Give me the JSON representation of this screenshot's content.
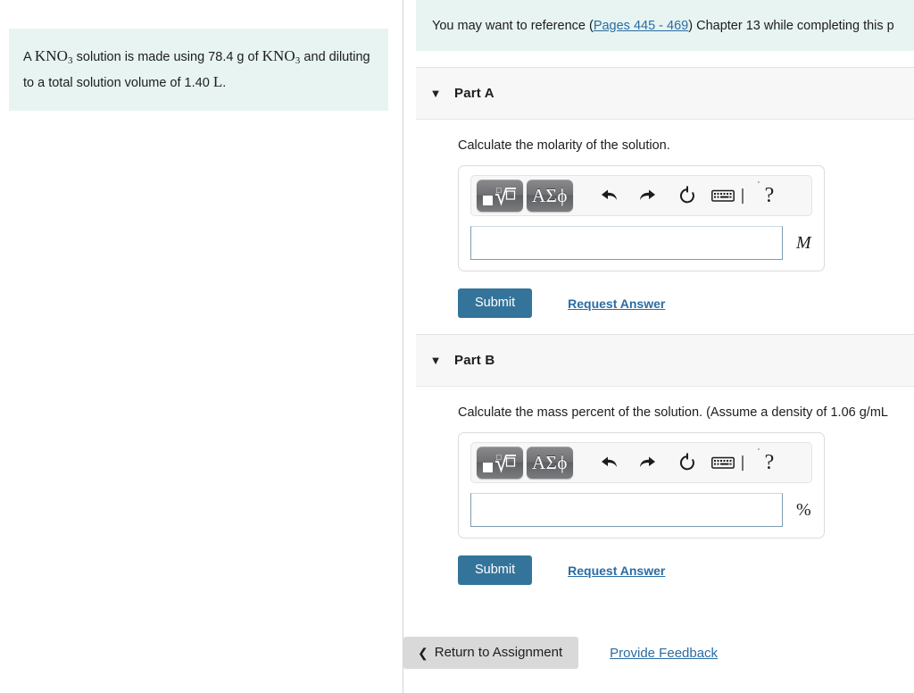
{
  "left": {
    "problem": {
      "line1_pre": "A ",
      "formula1": "KNO",
      "formula1_sub": "3",
      "line1_mid": " solution is made using 78.4 g of ",
      "formula2": "KNO",
      "formula2_sub": "3",
      "line1_post": " and diluting to a total solution volume of 1.40 ",
      "unit": "L",
      "period": "."
    }
  },
  "reference": {
    "pre": "You may want to reference (",
    "link": "Pages 445 - 469",
    "post": ") Chapter 13 while completing this p"
  },
  "parts": [
    {
      "caret": "▼",
      "title": "Part A",
      "question": "Calculate the molarity of the solution.",
      "input_value": "",
      "unit": "M",
      "unit_italic": true,
      "submit_label": "Submit",
      "request_label": "Request Answer"
    },
    {
      "caret": "▼",
      "title": "Part B",
      "question": "Calculate the mass percent of the solution. (Assume a density of 1.06 g/mL",
      "input_value": "",
      "unit": "%",
      "unit_italic": false,
      "submit_label": "Submit",
      "request_label": "Request Answer"
    }
  ],
  "toolbar": {
    "template_button": "template-icon",
    "greek_label": "ΑΣϕ",
    "undo_icon": "undo-icon",
    "redo_icon": "redo-icon",
    "reset_icon": "reset-icon",
    "keyboard_icon": "keyboard-icon",
    "keyboard_cursor": "❘",
    "help_label": "?"
  },
  "footer": {
    "return_chevron": "❮",
    "return_label": "Return to Assignment",
    "feedback_label": "Provide Feedback"
  },
  "colors": {
    "banner_bg": "#e7f4f2",
    "submit_blue": "#35749a",
    "link_blue": "#2b6ca3",
    "header_gray": "#f7f7f7",
    "return_gray": "#d9d9d9"
  }
}
